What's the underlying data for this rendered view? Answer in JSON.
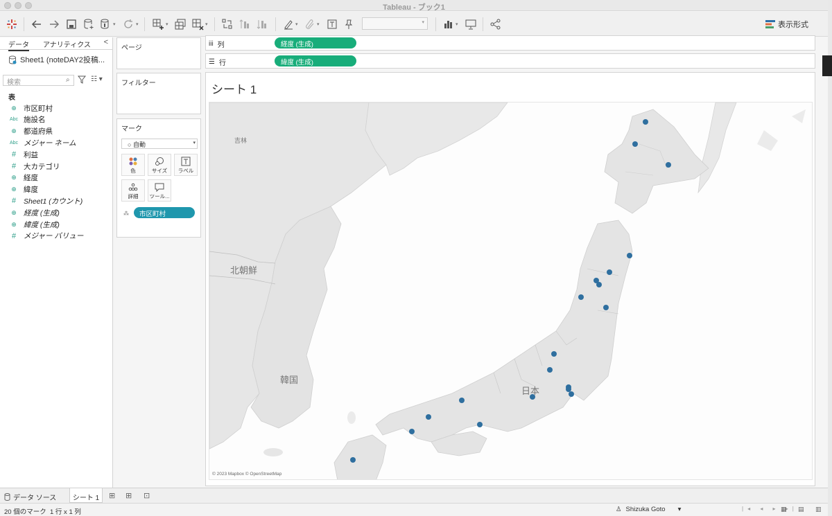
{
  "window": {
    "title": "Tableau - ブック1"
  },
  "toolbar": {
    "format_label": "表示形式"
  },
  "data_pane": {
    "tab_data": "データ",
    "tab_analytics": "アナリティクス",
    "collapse": "<",
    "datasource": "Sheet1 (noteDAY2投稿...",
    "search_placeholder": "検索",
    "section": "表",
    "fields": [
      {
        "icon": "globe-icon",
        "glyph": "⊕",
        "name": "市区町村",
        "italic": false
      },
      {
        "icon": "abc-icon",
        "glyph": "Abc",
        "name": "施設名",
        "italic": false
      },
      {
        "icon": "globe-icon",
        "glyph": "⊕",
        "name": "都道府県",
        "italic": false
      },
      {
        "icon": "abc-icon",
        "glyph": "Abc",
        "name": "メジャー ネーム",
        "italic": true
      },
      {
        "icon": "hash-icon",
        "glyph": "#",
        "name": "利益",
        "italic": false
      },
      {
        "icon": "hash-icon",
        "glyph": "#",
        "name": "大カテゴリ",
        "italic": false
      },
      {
        "icon": "globe-icon",
        "glyph": "⊕",
        "name": "経度",
        "italic": false
      },
      {
        "icon": "globe-icon",
        "glyph": "⊕",
        "name": "緯度",
        "italic": false
      },
      {
        "icon": "hash-icon",
        "glyph": "#",
        "name": "Sheet1 (カウント)",
        "italic": true
      },
      {
        "icon": "globe-icon",
        "glyph": "⊕",
        "name": "経度 (生成)",
        "italic": true
      },
      {
        "icon": "globe-icon",
        "glyph": "⊕",
        "name": "緯度 (生成)",
        "italic": true
      },
      {
        "icon": "hash-icon",
        "glyph": "#",
        "name": "メジャー バリュー",
        "italic": true
      }
    ]
  },
  "shelves": {
    "pages": "ページ",
    "filters": "フィルター",
    "marks": "マーク",
    "mark_type": "自動",
    "mark_buttons": {
      "color": "色",
      "size": "サイズ",
      "label": "ラベル",
      "detail": "詳細",
      "tooltip": "ツール..."
    },
    "detail_pill": "市区町村",
    "columns_label": "列",
    "columns_pill": "経度 (生成)",
    "rows_label": "行",
    "rows_pill": "緯度 (生成)"
  },
  "view": {
    "sheet_title": "シート 1",
    "map_labels": {
      "jilin": "吉林",
      "north_korea": "北朝鮮",
      "south_korea": "韓国",
      "japan": "日本"
    },
    "attribution": "© 2023 Mapbox © OpenStreetMap",
    "mark_color": "#2f6f9f",
    "mark_count": 20
  },
  "bottom": {
    "datasource_tab": "データ ソース",
    "sheet_tab": "シート 1",
    "status_marks": "20 個のマーク",
    "status_grid": "1 行 x 1 列",
    "user": "Shizuka Goto"
  }
}
